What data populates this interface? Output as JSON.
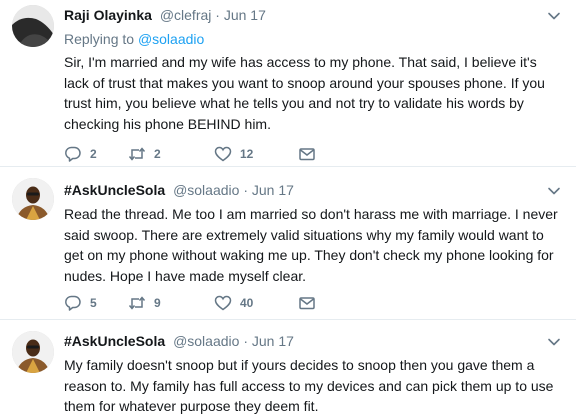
{
  "tweets": [
    {
      "name": "Raji Olayinka",
      "handle": "@clefraj",
      "separator": "·",
      "time": "Jun 17",
      "replying_prefix": "Replying to",
      "replying_to": "@solaadio",
      "text": "Sir, I'm married and my wife has access to my phone. That said, I believe it's lack of trust that makes you want to snoop around your spouses phone. If you trust him, you believe what he tells you and not try to validate his words by checking his phone BEHIND him.",
      "replies": "2",
      "retweets": "2",
      "likes": "12"
    },
    {
      "name": "#AskUncleSola",
      "handle": "@solaadio",
      "separator": "·",
      "time": "Jun 17",
      "text": "Read the thread. Me too I am married so don't harass me with marriage. I never said swoop. There are extremely valid situations why my family would want to get on my phone without waking me up. They don't check my phone looking for nudes. Hope I have made myself clear.",
      "replies": "5",
      "retweets": "9",
      "likes": "40"
    },
    {
      "name": "#AskUncleSola",
      "handle": "@solaadio",
      "separator": "·",
      "time": "Jun 17",
      "text": "My family doesn't snoop but if yours decides to snoop then you gave them a reason to. My family has full access to my devices and can pick them up to use them for whatever purpose they deem fit."
    }
  ],
  "icons": {
    "reply": "reply-icon",
    "retweet": "retweet-icon",
    "like": "heart-icon",
    "dm": "envelope-icon",
    "caret": "chevron-down-icon"
  },
  "colors": {
    "text": "#14171a",
    "muted": "#657786",
    "link": "#1da1f2",
    "divider": "#e6ecf0"
  }
}
